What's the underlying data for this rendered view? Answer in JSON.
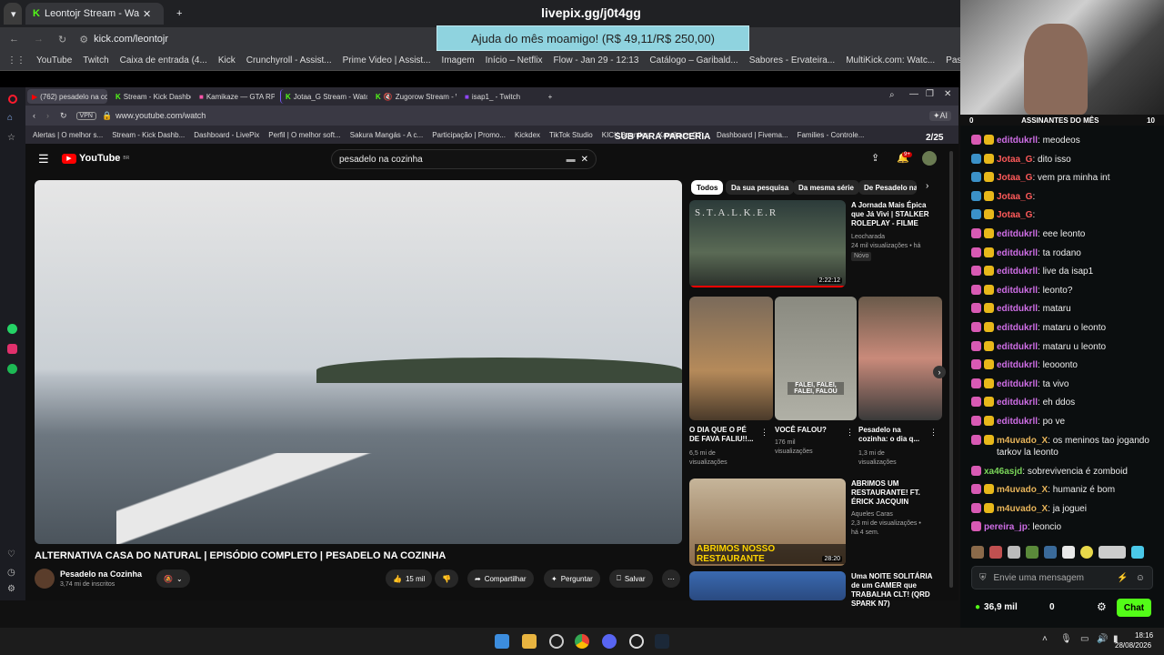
{
  "outer_browser": {
    "tabs": [
      {
        "label": "Leontojr Stream - Watch Live o"
      }
    ],
    "address": "kick.com/leontojr",
    "bookmarks": [
      "YouTube",
      "Twitch",
      "Caixa de entrada (4...",
      "Kick",
      "Crunchyroll - Assist...",
      "Prime Video | Assist...",
      "Imagem",
      "Início – Netflix",
      "Flow - Jan 29 - 12:13",
      "Catálogo – Garibald...",
      "Sabores - Ervateira...",
      "MultiKick.com: Watc...",
      "Past"
    ]
  },
  "overlay": {
    "livepix_url": "livepix.gg/j0t4gg",
    "donation_goal": "Ajuda do mês moamigo! (R$ 49,11/R$ 250,00)",
    "sub_banner": "SUB PARA PARCERIA",
    "sub_counter": "2/25"
  },
  "inner_browser": {
    "tabs": [
      "(762) pesadelo na coz",
      "Stream - Kick Dashboard",
      "Kamikaze — GTA RP",
      "Jotaa_G Stream - Watch Li",
      "Zugorow Stream - Wa",
      "isap1_ - Twitch"
    ],
    "address": "www.youtube.com/watch",
    "bookmarks": [
      "Alertas | O melhor s...",
      "Stream - Kick Dashb...",
      "Dashboard - LivePix",
      "Perfil | O melhor soft...",
      "Sakura Mangás - A c...",
      "Participação | Promo...",
      "Kickdex",
      "TikTok Studio",
      "KICK Bounties",
      "Kamikaze GT...",
      "Dashboard | Fivema...",
      "Families - Controle..."
    ]
  },
  "youtube": {
    "logo": "YouTube",
    "logo_region": "BR",
    "search_query": "pesadelo na cozinha",
    "notif_count": "9+",
    "video_title": "ALTERNATIVA CASA DO NATURAL | EPISÓDIO COMPLETO | PESADELO NA COZINHA",
    "channel_name": "Pesadelo na Cozinha",
    "subscribers": "3,74 mi de inscritos",
    "likes": "15 mil",
    "share_label": "Compartilhar",
    "ask_label": "Perguntar",
    "save_label": "Salvar",
    "chips": [
      "Todos",
      "Da sua pesquisa",
      "Da mesma série",
      "De Pesadelo na"
    ],
    "rec_main": [
      {
        "title": "A Jornada Mais Épica que Já Vivi | STALKER ROLEPLAY - FILME",
        "channel": "Leocharada",
        "meta": "24 mil visualizações • há 20 h",
        "badge": "Novo",
        "duration": "2:22:12",
        "thumb_text": "S.T.A.L.K.E.R"
      },
      {
        "title": "ABRIMOS UM RESTAURANTE! FT. ÉRICK JACQUIN",
        "channel": "Aqueles Caras",
        "meta": "2,3 mi de visualizações • há 4 sem.",
        "duration": "28:20",
        "thumb_text": "ABRIMOS NOSSO RESTAURANTE"
      },
      {
        "title": "Uma NOITE SOLITÁRIA de um GAMER que TRABALHA CLT! (QRD SPARK N7)",
        "channel": "",
        "meta": "",
        "duration": ""
      }
    ],
    "shorts": [
      {
        "title": "O DIA QUE O PÉ DE FAVA FALIU!!...",
        "views": "6,5 mi de visualizações"
      },
      {
        "title": "VOCÊ FALOU?",
        "views": "176 mil visualizações",
        "thumb_text": "FALEI, FALEI, FALEI, FALOU"
      },
      {
        "title": "Pesadelo na cozinha: o dia q...",
        "views": "1,3 mi de visualizações"
      }
    ]
  },
  "chat": {
    "subs_header": "ASSINANTES DO MÊS",
    "subs_left": "0",
    "subs_right": "10",
    "messages": [
      {
        "user": "editdukrll",
        "text": "meodeos",
        "color": "#cf6ee6"
      },
      {
        "user": "Jotaa_G",
        "text": "dito isso",
        "color": "#ff5a5a"
      },
      {
        "user": "Jotaa_G",
        "text": "vem pra minha int",
        "color": "#ff5a5a"
      },
      {
        "user": "Jotaa_G",
        "text": "",
        "color": "#ff5a5a"
      },
      {
        "user": "Jotaa_G",
        "text": "",
        "color": "#ff5a5a"
      },
      {
        "user": "editdukrll",
        "text": "eee leonto",
        "color": "#cf6ee6"
      },
      {
        "user": "editdukrll",
        "text": "ta rodano",
        "color": "#cf6ee6"
      },
      {
        "user": "editdukrll",
        "text": "live da isap1",
        "color": "#cf6ee6"
      },
      {
        "user": "editdukrll",
        "text": "leonto?",
        "color": "#cf6ee6"
      },
      {
        "user": "editdukrll",
        "text": "mataru",
        "color": "#cf6ee6"
      },
      {
        "user": "editdukrll",
        "text": "mataru o leonto",
        "color": "#cf6ee6"
      },
      {
        "user": "editdukrll",
        "text": "mataru u leonto",
        "color": "#cf6ee6"
      },
      {
        "user": "editdukrll",
        "text": "leooonto",
        "color": "#cf6ee6"
      },
      {
        "user": "editdukrll",
        "text": "ta vivo",
        "color": "#cf6ee6"
      },
      {
        "user": "editdukrll",
        "text": "eh ddos",
        "color": "#cf6ee6"
      },
      {
        "user": "editdukrll",
        "text": "po ve",
        "color": "#cf6ee6"
      },
      {
        "user": "m4uvado_X",
        "text": "os meninos tao jogando tarkov la leonto",
        "color": "#e7b45a"
      },
      {
        "user": "xa46asjd",
        "text": "sobrevivencia é zomboid",
        "color": "#7bd65a"
      },
      {
        "user": "m4uvado_X",
        "text": "humaniz é bom",
        "color": "#e7b45a"
      },
      {
        "user": "m4uvado_X",
        "text": "ja joguei",
        "color": "#e7b45a"
      },
      {
        "user": "pereira_jp",
        "text": "leoncio",
        "color": "#cf6ee6"
      }
    ],
    "input_placeholder": "Envie uma mensagem",
    "viewers": "36,9 mil",
    "points": "0",
    "send_label": "Chat"
  },
  "taskbar": {
    "time": "18:16",
    "date": "28/08/2026"
  },
  "colors": {
    "kick_green": "#53fc18",
    "yt_red": "#ff0000"
  }
}
